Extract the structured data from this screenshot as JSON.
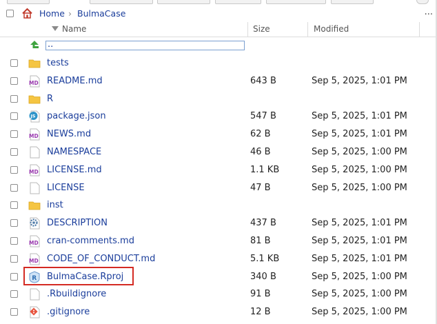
{
  "breadcrumb": {
    "items": [
      "Home",
      "BulmaCase"
    ],
    "more_label": "..."
  },
  "columns": {
    "name": "Name",
    "size": "Size",
    "modified": "Modified"
  },
  "parent_dir_label": "..",
  "files": [
    {
      "name": "tests",
      "size": "",
      "modified": "",
      "icon": "folder-icon"
    },
    {
      "name": "README.md",
      "size": "643 B",
      "modified": "Sep 5, 2025, 1:01 PM",
      "icon": "markdown-file-icon"
    },
    {
      "name": "R",
      "size": "",
      "modified": "",
      "icon": "folder-icon"
    },
    {
      "name": "package.json",
      "size": "547 B",
      "modified": "Sep 5, 2025, 1:01 PM",
      "icon": "json-file-icon"
    },
    {
      "name": "NEWS.md",
      "size": "62 B",
      "modified": "Sep 5, 2025, 1:01 PM",
      "icon": "markdown-file-icon"
    },
    {
      "name": "NAMESPACE",
      "size": "46 B",
      "modified": "Sep 5, 2025, 1:00 PM",
      "icon": "text-file-icon"
    },
    {
      "name": "LICENSE.md",
      "size": "1.1 KB",
      "modified": "Sep 5, 2025, 1:00 PM",
      "icon": "markdown-file-icon"
    },
    {
      "name": "LICENSE",
      "size": "47 B",
      "modified": "Sep 5, 2025, 1:00 PM",
      "icon": "text-file-icon"
    },
    {
      "name": "inst",
      "size": "",
      "modified": "",
      "icon": "folder-icon"
    },
    {
      "name": "DESCRIPTION",
      "size": "437 B",
      "modified": "Sep 5, 2025, 1:01 PM",
      "icon": "gear-file-icon"
    },
    {
      "name": "cran-comments.md",
      "size": "81 B",
      "modified": "Sep 5, 2025, 1:01 PM",
      "icon": "markdown-file-icon"
    },
    {
      "name": "CODE_OF_CONDUCT.md",
      "size": "5.1 KB",
      "modified": "Sep 5, 2025, 1:01 PM",
      "icon": "markdown-file-icon"
    },
    {
      "name": "BulmaCase.Rproj",
      "size": "340 B",
      "modified": "Sep 5, 2025, 1:00 PM",
      "icon": "rproj-file-icon"
    },
    {
      "name": ".Rbuildignore",
      "size": "91 B",
      "modified": "Sep 5, 2025, 1:00 PM",
      "icon": "text-file-icon"
    },
    {
      "name": ".gitignore",
      "size": "12 B",
      "modified": "Sep 5, 2025, 1:00 PM",
      "icon": "git-file-icon"
    }
  ],
  "colors": {
    "link": "#1a3d9b",
    "folder": "#f5c542",
    "highlight_border": "#d42a22",
    "up_arrow": "#3fa33f"
  }
}
